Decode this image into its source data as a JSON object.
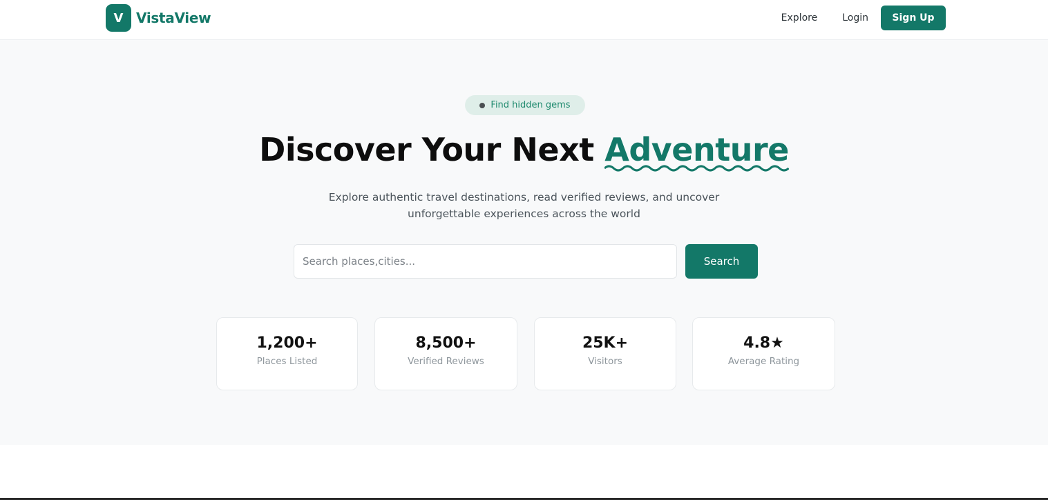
{
  "header": {
    "brand": {
      "mark": "V",
      "name": "VistaView"
    },
    "nav": {
      "explore": "Explore",
      "login": "Login",
      "signup": "Sign Up"
    }
  },
  "hero": {
    "badge": "Find hidden gems",
    "title_main": "Discover Your Next ",
    "title_accent": "Adventure",
    "subtitle_line1": "Explore authentic travel destinations, read verified reviews, and uncover",
    "subtitle_line2": "unforgettable experiences across the world",
    "search": {
      "placeholder": "Search places,cities...",
      "button": "Search"
    }
  },
  "stats": [
    {
      "value": "1,200+",
      "label": "Places Listed"
    },
    {
      "value": "8,500+",
      "label": "Verified Reviews"
    },
    {
      "value": "25K+",
      "label": "Visitors"
    },
    {
      "value": "4.8★",
      "label": "Average Rating"
    }
  ],
  "colors": {
    "brand": "#137868",
    "hero_background": "#f8f9fa",
    "badge_background": "#dfeee9"
  }
}
